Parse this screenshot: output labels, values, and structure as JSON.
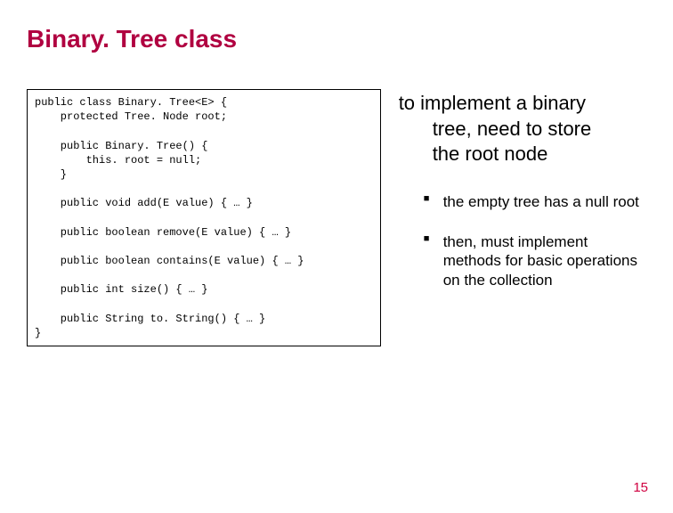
{
  "title": "Binary. Tree class",
  "code": "public class Binary. Tree<E> {\n    protected Tree. Node root;\n\n    public Binary. Tree() {\n        this. root = null;\n    }\n\n    public void add(E value) { … }\n\n    public boolean remove(E value) { … }\n\n    public boolean contains(E value) { … }\n\n    public int size() { … }\n\n    public String to. String() { … }\n}",
  "rightcol": {
    "para_line1": "to implement a binary",
    "para_line2": "tree, need to store",
    "para_line3": "the root node",
    "bullets": [
      "the empty tree has a null root",
      "then, must implement methods for basic operations on the collection"
    ]
  },
  "page_number": "15"
}
